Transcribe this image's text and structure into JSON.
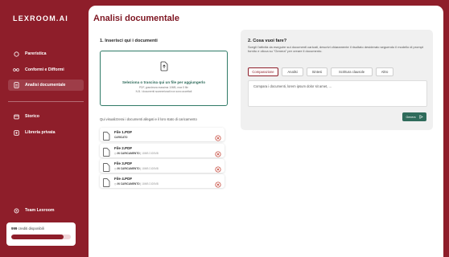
{
  "sidebar": {
    "logo": "LEXROOM.AI",
    "items": [
      {
        "label": "Pareristica",
        "icon": "circle-icon"
      },
      {
        "label": "Conformi e Difformi",
        "icon": "infinity-icon"
      },
      {
        "label": "Analisi documentale",
        "icon": "document-icon",
        "active": true
      },
      {
        "label": "Storico",
        "icon": "archive-icon"
      },
      {
        "label": "Libreria privata",
        "icon": "plus-square-icon"
      },
      {
        "label": "Team Lexroom",
        "icon": "settings-icon"
      }
    ],
    "credits": {
      "count": "999",
      "label": "crediti disponibili",
      "fill_fraction": 0.88
    }
  },
  "main": {
    "title": "Analisi documentale",
    "section1": {
      "title": "1. Inserisci qui i documenti",
      "dropzone": {
        "title": "Seleziona o trascina qui un file per aggiungerlo",
        "line1": "PDF, grandezza massima 10MB, max 5 file",
        "line2": "N.B. i documenti scannerizzati non sono accettati"
      },
      "hint": "Qui visualizzerai i documenti allegati e il loro stato di caricamento",
      "files": [
        {
          "name": "File 1.PDF",
          "status": "CARICATO",
          "size": ""
        },
        {
          "name": "File 2.PDF",
          "status": "IN CARICAMENTO",
          "size": "18MB DI20MB"
        },
        {
          "name": "File 3.PDF",
          "status": "IN CARICAMENTO",
          "size": "18MB DI20MB"
        },
        {
          "name": "File 4.PDF",
          "status": "IN CARICAMENTO",
          "size": "18MB DI20MB"
        }
      ]
    },
    "section2": {
      "title": "2. Cosa vuoi fare?",
      "description": "Scegli l'attività da eseguire sui documenti caricati, descrivi chiaramente il risultato desiderato seguendo il modello di prompt fornito e clicca su \"Genera\" per creare il documento.",
      "tabs": [
        "Comparazione",
        "Analisi",
        "Sintesi",
        "Scrittura clausole",
        "Altro"
      ],
      "active_tab": "Comparazione",
      "prompt_value": "Compara i documenti, lorem ipsum dolor sit amet, ...",
      "generate_label": "Genera"
    }
  },
  "colors": {
    "brand": "#8e1e2a",
    "accent": "#2f6b5b",
    "panel": "#f0f0f0"
  }
}
